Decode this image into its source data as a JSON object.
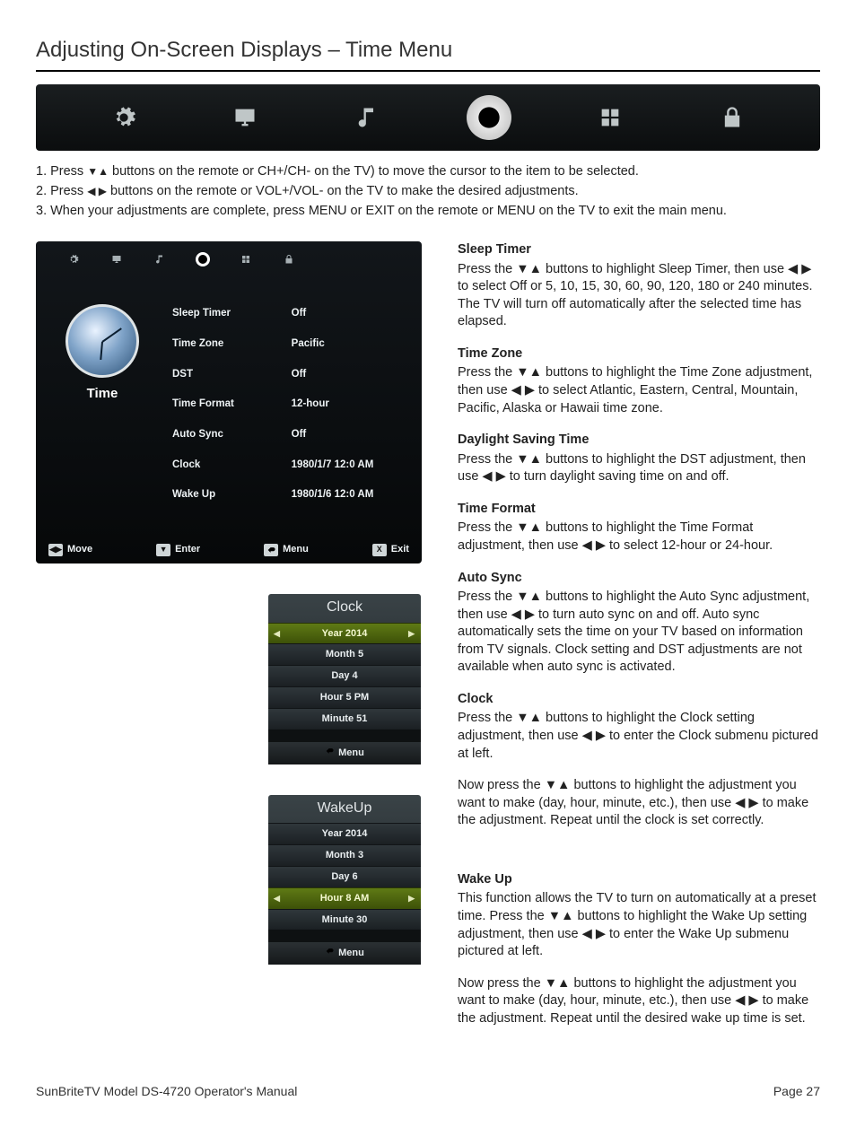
{
  "title": "Adjusting On-Screen Displays – Time Menu",
  "steps": [
    {
      "n": "1.",
      "pre": "Press ",
      "icon": "down-up",
      "post": " buttons on the remote or CH+/CH- on the TV) to move the cursor to the item to be selected."
    },
    {
      "n": "2.",
      "pre": "Press ",
      "icon": "left-right",
      "post": " buttons on the remote or VOL+/VOL- on the TV to make the desired adjustments."
    },
    {
      "n": "3.",
      "pre": "When your adjustments are complete, press MENU or EXIT on the remote or MENU on the TV to exit the main menu.",
      "icon": "",
      "post": ""
    }
  ],
  "tv": {
    "side_label": "Time",
    "rows": [
      {
        "label": "Sleep Timer",
        "value": "Off"
      },
      {
        "label": "Time Zone",
        "value": "Pacific"
      },
      {
        "label": "DST",
        "value": "Off"
      },
      {
        "label": "Time Format",
        "value": "12-hour"
      },
      {
        "label": "Auto Sync",
        "value": "Off"
      },
      {
        "label": "Clock",
        "value": "1980/1/7 12:0 AM"
      },
      {
        "label": "Wake Up",
        "value": "1980/1/6 12:0 AM"
      }
    ],
    "footer": {
      "move": "Move",
      "enter": "Enter",
      "menu": "Menu",
      "exit_key": "X",
      "exit": "Exit"
    }
  },
  "clock_panel": {
    "title": "Clock",
    "rows": [
      "Year 2014",
      "Month 5",
      "Day 4",
      "Hour 5   PM",
      "Minute 51"
    ],
    "selected_index": 0,
    "foot": "Menu"
  },
  "wake_panel": {
    "title": "WakeUp",
    "rows": [
      "Year 2014",
      "Month 3",
      "Day 6",
      "Hour 8   AM",
      "Minute 30"
    ],
    "selected_index": 3,
    "foot": "Menu"
  },
  "sections": {
    "sleep": {
      "h": "Sleep Timer",
      "p": "Press the ▼▲ buttons to highlight Sleep Timer, then use ◀ ▶ to select Off or 5, 10, 15, 30, 60, 90, 120, 180 or 240 minutes. The TV will turn off automatically after the selected time has elapsed."
    },
    "tz": {
      "h": "Time Zone",
      "p": "Press the ▼▲ buttons to highlight the Time Zone adjustment, then use ◀ ▶ to select Atlantic, Eastern, Central, Mountain, Pacific, Alaska or Hawaii time zone."
    },
    "dst": {
      "h": "Daylight Saving Time",
      "p": "Press the ▼▲ buttons to highlight the DST adjustment, then use ◀ ▶ to turn daylight saving time on and off."
    },
    "fmt": {
      "h": "Time Format",
      "p": "Press the ▼▲ buttons to highlight the Time Format adjustment, then use ◀ ▶ to select 12-hour or 24-hour."
    },
    "sync": {
      "h": "Auto Sync",
      "p": "Press the ▼▲ buttons to highlight the Auto Sync adjustment, then use ◀ ▶ to turn auto sync on and off. Auto sync automatically sets the time on your TV based on information from TV signals. Clock setting and DST adjustments are not available when auto sync is activated."
    },
    "clock1": {
      "h": "Clock",
      "p": "Press the ▼▲ buttons to highlight the Clock setting adjustment, then use ◀ ▶ to enter the Clock submenu pictured at left."
    },
    "clock2": {
      "p": "Now press the ▼▲ buttons to highlight the adjustment you want to make (day, hour, minute, etc.), then use ◀ ▶ to make the adjustment. Repeat until the clock is set correctly."
    },
    "wake1": {
      "h": "Wake Up",
      "p": "This function allows the TV to turn on automatically at a preset time. Press the ▼▲ buttons to highlight the Wake Up setting adjustment, then use ◀ ▶ to enter the  Wake Up submenu pictured at left."
    },
    "wake2": {
      "p": "Now press the ▼▲ buttons to highlight the adjustment you want to make (day, hour, minute, etc.), then use ◀ ▶ to make the adjustment. Repeat until the desired wake up time is set."
    }
  },
  "footer": {
    "left": "SunBriteTV Model DS-4720 Operator's Manual",
    "right": "Page 27"
  }
}
